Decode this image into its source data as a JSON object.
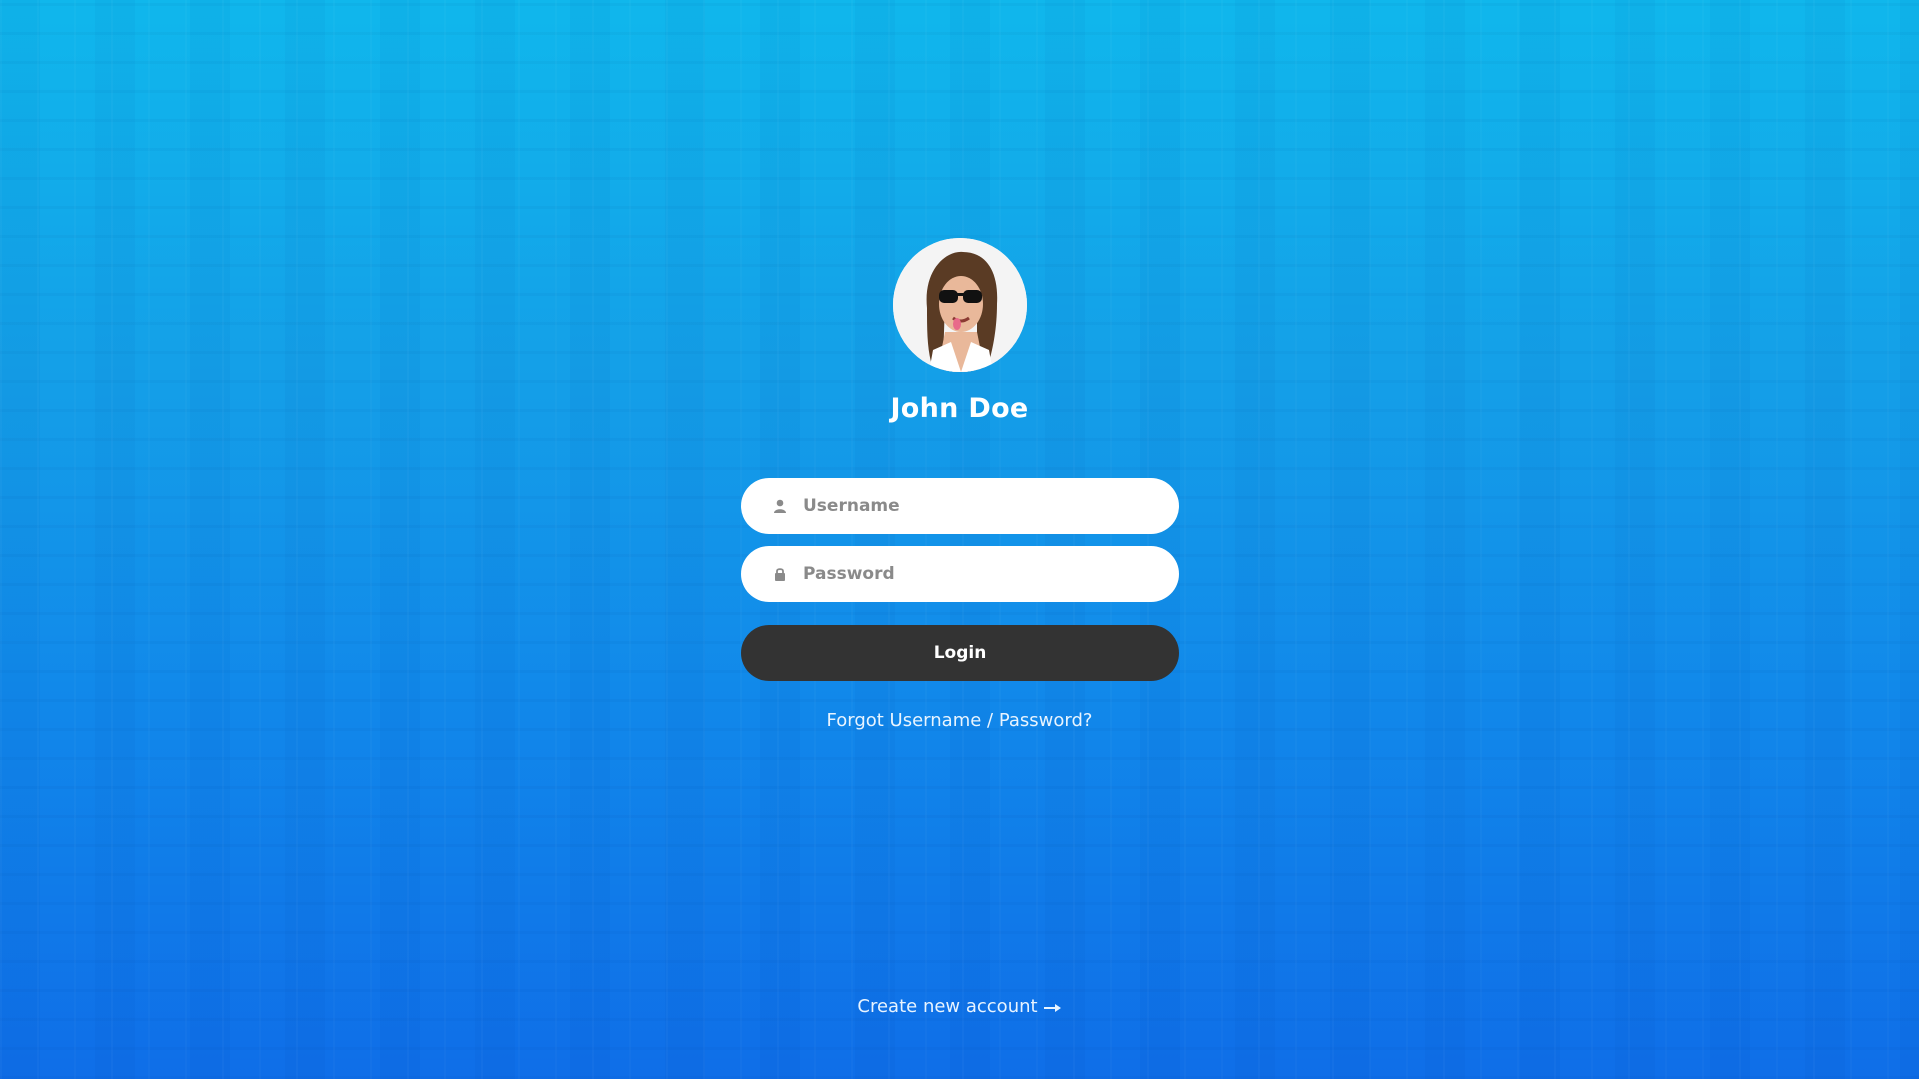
{
  "profile": {
    "name": "John Doe"
  },
  "form": {
    "username_placeholder": "Username",
    "password_placeholder": "Password",
    "login_label": "Login",
    "forgot_link": "Forgot Username / Password?"
  },
  "footer": {
    "create_account_link": "Create new account"
  },
  "icons": {
    "username": "user-icon",
    "password": "lock-icon",
    "create_account": "arrow-right-icon"
  },
  "colors": {
    "background_top": "#10b7ec",
    "background_bottom": "#0f6ee8",
    "button": "#333333",
    "input_bg": "#ffffff"
  }
}
